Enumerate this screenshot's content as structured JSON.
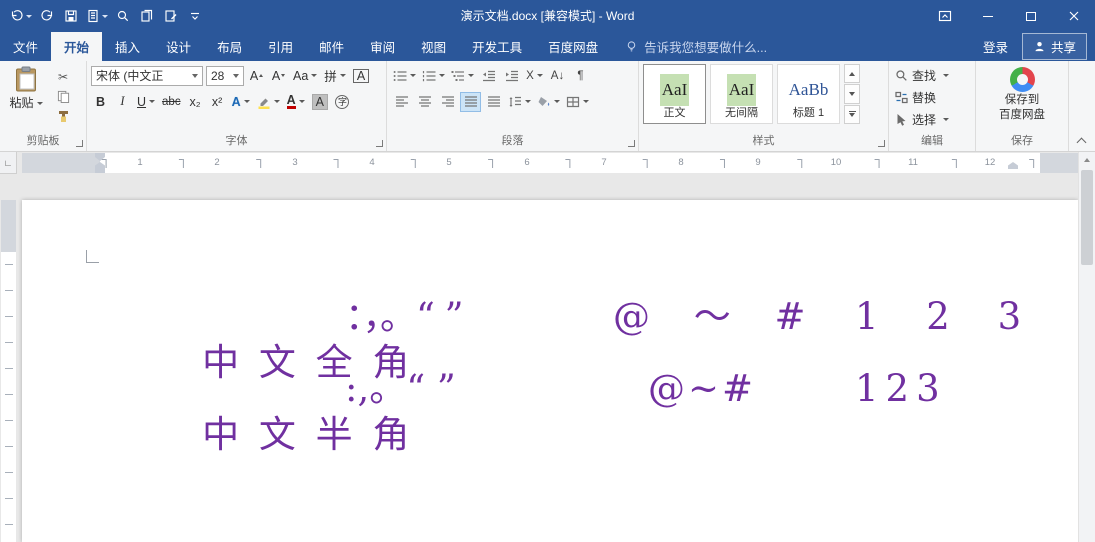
{
  "colors": {
    "titlebar_blue": "#2b579a",
    "ribbon_bg": "#f5f6f7",
    "document_text_purple": "#7030a0",
    "style_preview_highlight": "#c5e0b3",
    "heading_blue": "#2f5496"
  },
  "titlebar": {
    "title": "演示文档.docx [兼容模式] - Word"
  },
  "tabs": {
    "file": "文件",
    "home": "开始",
    "insert": "插入",
    "design": "设计",
    "layout": "布局",
    "references": "引用",
    "mailings": "邮件",
    "review": "审阅",
    "view": "视图",
    "developer": "开发工具",
    "baidu_pan": "百度网盘",
    "tell_me": "告诉我您想要做什么...",
    "sign_in": "登录",
    "share": "共享"
  },
  "ribbon": {
    "clipboard": {
      "label": "剪贴板",
      "paste": "粘贴"
    },
    "font": {
      "label": "字体",
      "name_value": "宋体 (中文正",
      "size_value": "28",
      "grow": "A",
      "shrink": "A",
      "change_case": "Aa",
      "phonetic": "拼",
      "char_border": "A",
      "bold": "B",
      "italic": "I",
      "underline": "U",
      "strikethrough": "abc",
      "subscript": "x₂",
      "superscript": "x²",
      "text_effects": "A",
      "font_color": "A",
      "char_shading": "A",
      "enclose": "字"
    },
    "paragraph": {
      "label": "段落",
      "asian_layout": "X",
      "sort": "A↓",
      "show_marks": "¶"
    },
    "styles": {
      "label": "样式",
      "items": [
        {
          "preview": "AaI",
          "name": "正文"
        },
        {
          "preview": "AaI",
          "name": "无间隔"
        },
        {
          "preview": "AaBb",
          "name": "标题 1"
        }
      ]
    },
    "editing": {
      "label": "编辑",
      "find": "查找",
      "replace": "替换",
      "select": "选择"
    },
    "baidu_save": {
      "label": "保存",
      "button_line1": "保存到",
      "button_line2": "百度网盘"
    }
  },
  "ruler": {
    "numbers": [
      "1",
      "2",
      "3",
      "4",
      "5",
      "6",
      "7",
      "8",
      "9",
      "10",
      "11",
      "12"
    ]
  },
  "document": {
    "line1": {
      "seg1": "中 文 全 角",
      "seg2": "：，。“ ”",
      "seg3": "@ ～ #",
      "seg4": "1 2 3"
    },
    "line2": {
      "seg1": "中 文 半 角",
      "seg2": ":,。“ ”",
      "seg3": "@~#",
      "seg4": "123"
    }
  },
  "icons": {
    "cut": "✂",
    "tab_selector": "∟"
  }
}
